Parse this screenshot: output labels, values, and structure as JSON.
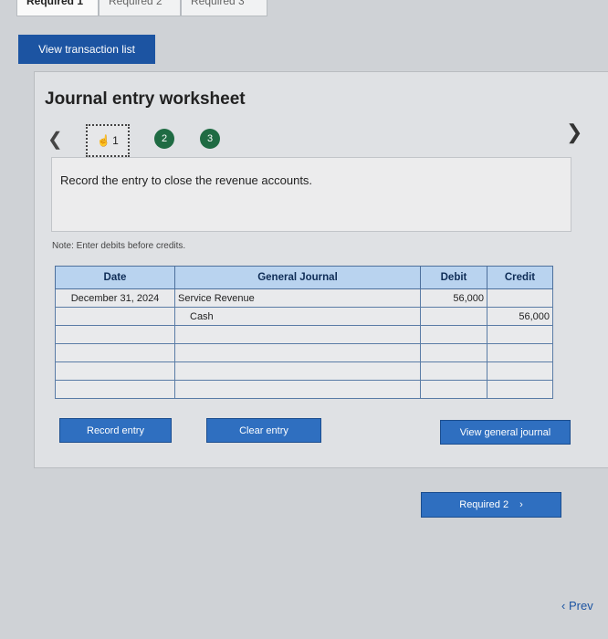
{
  "tabs": [
    "Required 1",
    "Required 2",
    "Required 3"
  ],
  "view_transaction_label": "View transaction list",
  "worksheet_title": "Journal entry worksheet",
  "steps": [
    "1",
    "2",
    "3"
  ],
  "description": "Record the entry to close the revenue accounts.",
  "note": "Note: Enter debits before credits.",
  "table": {
    "headers": {
      "date": "Date",
      "journal": "General Journal",
      "debit": "Debit",
      "credit": "Credit"
    },
    "rows": [
      {
        "date": "December 31, 2024",
        "account": "Service Revenue",
        "debit": "56,000",
        "credit": ""
      },
      {
        "date": "",
        "account": "Cash",
        "debit": "",
        "credit": "56,000"
      },
      {
        "date": "",
        "account": "",
        "debit": "",
        "credit": ""
      },
      {
        "date": "",
        "account": "",
        "debit": "",
        "credit": ""
      },
      {
        "date": "",
        "account": "",
        "debit": "",
        "credit": ""
      },
      {
        "date": "",
        "account": "",
        "debit": "",
        "credit": ""
      }
    ]
  },
  "buttons": {
    "record": "Record entry",
    "clear": "Clear entry",
    "view_journal": "View general journal",
    "required2": "Required 2",
    "prev": "Prev"
  }
}
